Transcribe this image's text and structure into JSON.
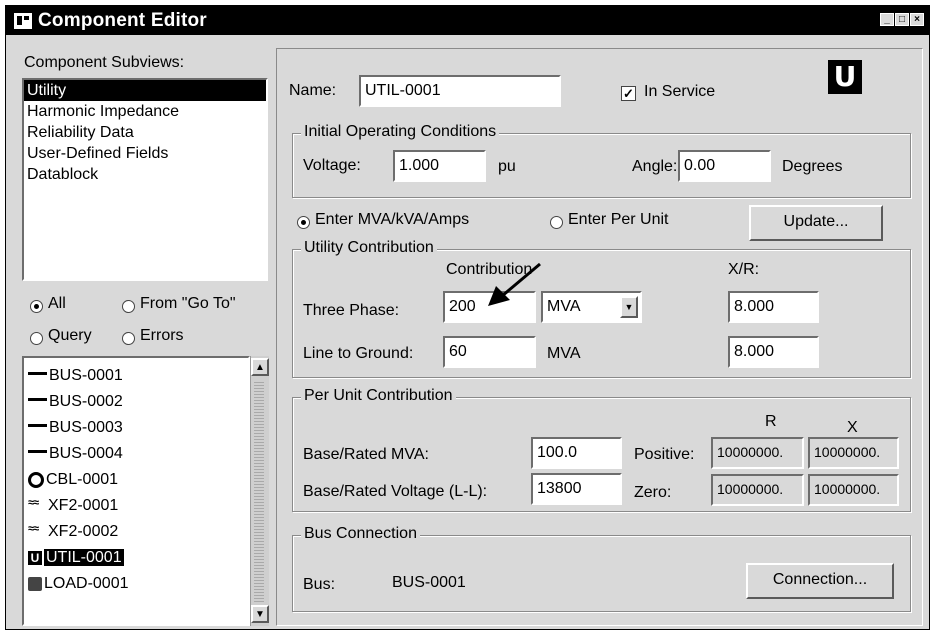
{
  "window": {
    "title": "Component Editor"
  },
  "left": {
    "subviews_label": "Component Subviews:",
    "subviews": [
      "Utility",
      "Harmonic Impedance",
      "Reliability Data",
      "User-Defined Fields",
      "Datablock"
    ],
    "selected_subview": "Utility",
    "filters": [
      {
        "label": "All",
        "selected": true
      },
      {
        "label": "From \"Go To\"",
        "selected": false
      },
      {
        "label": "Query",
        "selected": false
      },
      {
        "label": "Errors",
        "selected": false
      }
    ],
    "components": [
      {
        "icon": "bus-icon",
        "label": "BUS-0001"
      },
      {
        "icon": "bus-icon",
        "label": "BUS-0002"
      },
      {
        "icon": "bus-icon",
        "label": "BUS-0003"
      },
      {
        "icon": "bus-icon",
        "label": "BUS-0004"
      },
      {
        "icon": "cable-icon",
        "label": "CBL-0001"
      },
      {
        "icon": "transformer-icon",
        "label": "XF2-0001"
      },
      {
        "icon": "transformer-icon",
        "label": "XF2-0002"
      },
      {
        "icon": "utility-icon",
        "label": "UTIL-0001",
        "selected": true
      },
      {
        "icon": "load-icon",
        "label": "LOAD-0001"
      }
    ]
  },
  "main": {
    "name_label": "Name:",
    "name_value": "UTIL-0001",
    "in_service_label": "In Service",
    "in_service_checked": true,
    "logo_letter": "U",
    "initial_conditions": {
      "legend": "Initial Operating Conditions",
      "voltage_label": "Voltage:",
      "voltage_value": "1.000",
      "voltage_unit": "pu",
      "angle_label": "Angle:",
      "angle_value": "0.00",
      "angle_unit": "Degrees"
    },
    "entry_mode": {
      "mva_label": "Enter MVA/kVA/Amps",
      "per_unit_label": "Enter Per Unit",
      "selected": "mva",
      "update_label": "Update..."
    },
    "utility_contribution": {
      "legend": "Utility Contribution",
      "contribution_header": "Contribution",
      "xr_header": "X/R:",
      "three_phase_label": "Three Phase:",
      "three_phase_value": "200",
      "three_phase_unit": "MVA",
      "three_phase_xr": "8.000",
      "ltg_label": "Line to Ground:",
      "ltg_value": "60",
      "ltg_unit": "MVA",
      "ltg_xr": "8.000"
    },
    "per_unit_contribution": {
      "legend": "Per Unit Contribution",
      "base_mva_label": "Base/Rated MVA:",
      "base_mva_value": "100.0",
      "base_voltage_label": "Base/Rated Voltage (L-L):",
      "base_voltage_value": "13800",
      "r_header": "R",
      "x_header": "X",
      "positive_label": "Positive:",
      "positive_r": "10000000.",
      "positive_x": "10000000.",
      "zero_label": "Zero:",
      "zero_r": "10000000.",
      "zero_x": "10000000."
    },
    "bus_connection": {
      "legend": "Bus Connection",
      "bus_label": "Bus:",
      "bus_value": "BUS-0001",
      "connection_button": "Connection..."
    }
  }
}
